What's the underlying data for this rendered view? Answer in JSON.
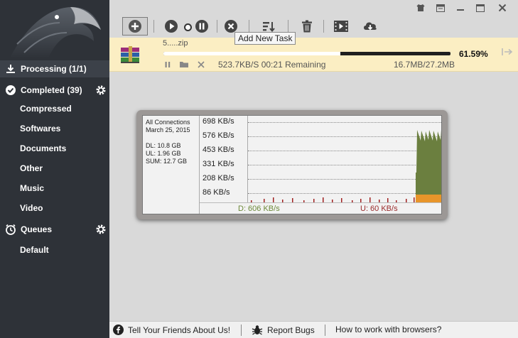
{
  "sidebar": {
    "processing": "Processing (1/1)",
    "completed": "Completed (39)",
    "categories": [
      "Compressed",
      "Softwares",
      "Documents",
      "Other",
      "Music",
      "Video"
    ],
    "queues": "Queues",
    "queue_items": [
      "Default"
    ]
  },
  "toolbar": {
    "tooltip": "Add New Task",
    "buttons": [
      "add-icon",
      "play-icon",
      "pause-icon",
      "stop-icon",
      "sort-icon",
      "delete-icon",
      "video-icon",
      "cloud-download-icon"
    ]
  },
  "task": {
    "filename": "5.....zip",
    "progress": 0.6159,
    "progress_label": "61.59%",
    "speed_remaining": "523.7KB/S 00:21 Remaining",
    "sizes": "16.7MB/27.2MB"
  },
  "graph": {
    "info": {
      "title": "All Connections",
      "date": "March 25, 2015",
      "dl": "DL: 10.8 GB",
      "ul": "UL: 1.96 GB",
      "sum": "SUM: 12.7 GB"
    },
    "ticks": [
      "698 KB/s",
      "576 KB/s",
      "453 KB/s",
      "331 KB/s",
      "208 KB/s",
      "86 KB/s"
    ],
    "download_label": "D: 606 KB/s",
    "upload_label": "U: 60 KB/s",
    "colors": {
      "download": "#6b7f3f",
      "upload": "#e8952a",
      "spikes": "#a02020"
    }
  },
  "bottombar": {
    "facebook": "Tell Your Friends About Us!",
    "bugs": "Report Bugs",
    "browsers": "How to work with browsers?"
  }
}
